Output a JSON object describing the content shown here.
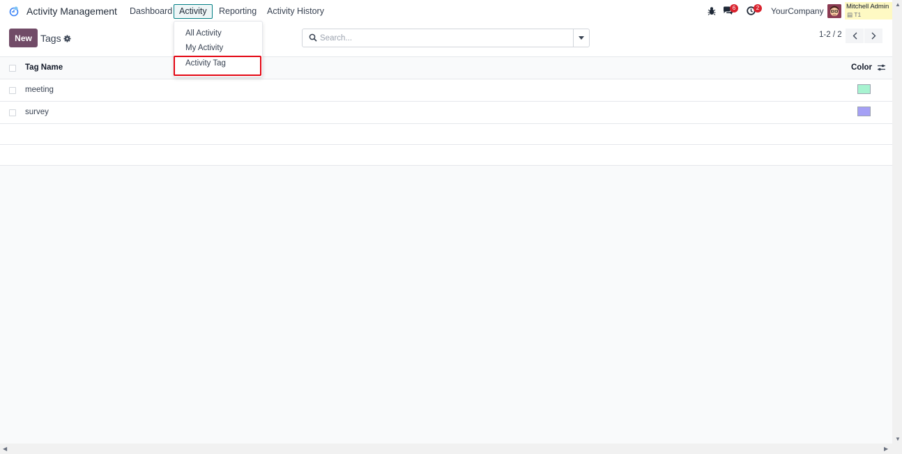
{
  "navbar": {
    "app_title": "Activity Management",
    "menu": [
      "Dashboard",
      "Activity",
      "Reporting",
      "Activity History"
    ],
    "active_menu": "Activity",
    "messages_badge": "6",
    "activities_badge": "2",
    "company": "YourCompany",
    "user_name": "Mitchell Admin",
    "database": "T1"
  },
  "activity_dropdown": {
    "items": [
      "All Activity",
      "My Activity",
      "Activity Tag"
    ],
    "highlighted": "Activity Tag"
  },
  "control_panel": {
    "new_label": "New",
    "breadcrumb": "Tags",
    "search_placeholder": "Search...",
    "pager": "1-2 / 2"
  },
  "list": {
    "columns": [
      "Tag Name",
      "Color"
    ],
    "rows": [
      {
        "name": "meeting",
        "color": "#a7f3d0"
      },
      {
        "name": "survey",
        "color": "#a5a0f5"
      }
    ]
  },
  "colors": {
    "brand": "#714b67",
    "active_menu_border": "#017e84",
    "highlight_box": "#e30613",
    "badge": "#d9232e"
  }
}
